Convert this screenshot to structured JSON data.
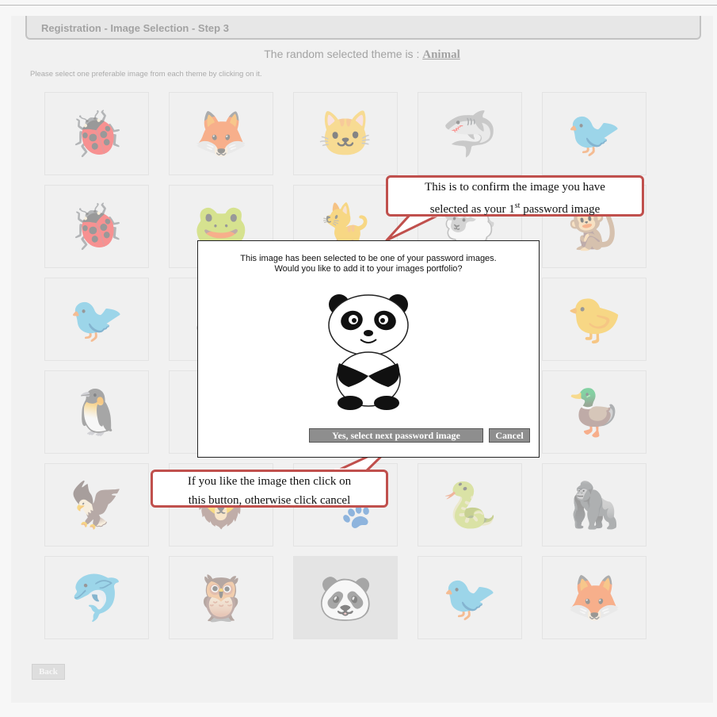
{
  "header": {
    "step_title": "Registration - Image Selection - Step 3"
  },
  "theme": {
    "prefix": "The random selected theme is : ",
    "name": "Animal"
  },
  "instruction": "Please select one preferable image from each theme by clicking on it.",
  "grid": {
    "cells": [
      {
        "icon": "ladybug-icon",
        "glyph": "🐞"
      },
      {
        "icon": "red-panda-icon",
        "glyph": "🦊"
      },
      {
        "icon": "cheshire-cat-icon",
        "glyph": "🐱"
      },
      {
        "icon": "shark-icon",
        "glyph": "🦈"
      },
      {
        "icon": "bird-icon",
        "glyph": "🐦"
      },
      {
        "icon": "ladybug-icon",
        "glyph": "🐞"
      },
      {
        "icon": "frog-icon",
        "glyph": "🐸"
      },
      {
        "icon": "black-cat-icon",
        "glyph": "🐈"
      },
      {
        "icon": "sheep-icon",
        "glyph": "🐑"
      },
      {
        "icon": "monkey-icon",
        "glyph": "🐒"
      },
      {
        "icon": "blue-bird-icon",
        "glyph": "🐦"
      },
      {
        "icon": "zebra-icon",
        "glyph": "🦓"
      },
      {
        "icon": "animal-icon",
        "glyph": "🐾"
      },
      {
        "icon": "animal-icon",
        "glyph": "🐾"
      },
      {
        "icon": "purple-bird-icon",
        "glyph": "🐤"
      },
      {
        "icon": "penguin-icon",
        "glyph": "🐧"
      },
      {
        "icon": "fox-icon",
        "glyph": "🦊"
      },
      {
        "icon": "animal-icon",
        "glyph": "🐾"
      },
      {
        "icon": "animal-icon",
        "glyph": "🐾"
      },
      {
        "icon": "duck-icon",
        "glyph": "🦆"
      },
      {
        "icon": "eagle-icon",
        "glyph": "🦅"
      },
      {
        "icon": "lion-icon",
        "glyph": "🦁"
      },
      {
        "icon": "animal-icon",
        "glyph": "🐾"
      },
      {
        "icon": "snake-icon",
        "glyph": "🐍"
      },
      {
        "icon": "gorilla-icon",
        "glyph": "🦍"
      },
      {
        "icon": "dolphin-icon",
        "glyph": "🐬"
      },
      {
        "icon": "owl-icon",
        "glyph": "🦉"
      },
      {
        "icon": "panda-icon",
        "glyph": "🐼",
        "selected": true
      },
      {
        "icon": "toucan-icon",
        "glyph": "🐦"
      },
      {
        "icon": "fox-icon",
        "glyph": "🦊"
      }
    ]
  },
  "back_button": {
    "label": "Back"
  },
  "modal": {
    "message_line1": "This image has been selected to be one of your password images.",
    "message_line2": "Would you like to add it to your images portfolio?",
    "image_icon": "panda-icon",
    "yes_label": "Yes, select next password image",
    "cancel_label": "Cancel"
  },
  "callouts": {
    "top_line1": "This is to confirm the image you have",
    "top_line2_pre": "selected as your 1",
    "top_line2_sup": "st",
    "top_line2_post": " password image",
    "bottom_line1": "If you like the image then click on",
    "bottom_line2": "this button, otherwise click cancel",
    "border_color": "#c0504d"
  }
}
